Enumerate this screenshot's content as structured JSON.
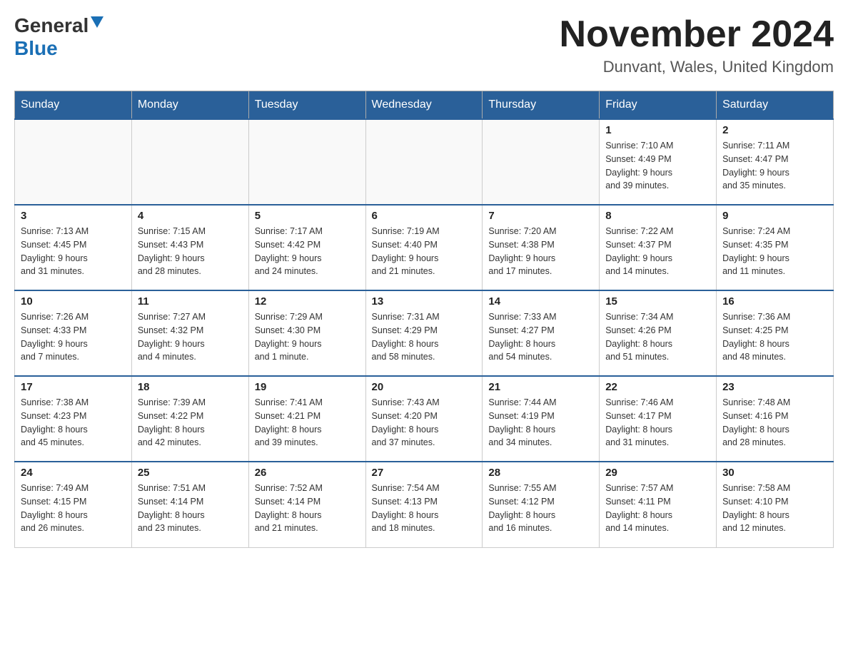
{
  "header": {
    "logo_general": "General",
    "logo_blue": "Blue",
    "title": "November 2024",
    "subtitle": "Dunvant, Wales, United Kingdom"
  },
  "weekdays": [
    "Sunday",
    "Monday",
    "Tuesday",
    "Wednesday",
    "Thursday",
    "Friday",
    "Saturday"
  ],
  "weeks": [
    [
      {
        "day": "",
        "info": ""
      },
      {
        "day": "",
        "info": ""
      },
      {
        "day": "",
        "info": ""
      },
      {
        "day": "",
        "info": ""
      },
      {
        "day": "",
        "info": ""
      },
      {
        "day": "1",
        "info": "Sunrise: 7:10 AM\nSunset: 4:49 PM\nDaylight: 9 hours\nand 39 minutes."
      },
      {
        "day": "2",
        "info": "Sunrise: 7:11 AM\nSunset: 4:47 PM\nDaylight: 9 hours\nand 35 minutes."
      }
    ],
    [
      {
        "day": "3",
        "info": "Sunrise: 7:13 AM\nSunset: 4:45 PM\nDaylight: 9 hours\nand 31 minutes."
      },
      {
        "day": "4",
        "info": "Sunrise: 7:15 AM\nSunset: 4:43 PM\nDaylight: 9 hours\nand 28 minutes."
      },
      {
        "day": "5",
        "info": "Sunrise: 7:17 AM\nSunset: 4:42 PM\nDaylight: 9 hours\nand 24 minutes."
      },
      {
        "day": "6",
        "info": "Sunrise: 7:19 AM\nSunset: 4:40 PM\nDaylight: 9 hours\nand 21 minutes."
      },
      {
        "day": "7",
        "info": "Sunrise: 7:20 AM\nSunset: 4:38 PM\nDaylight: 9 hours\nand 17 minutes."
      },
      {
        "day": "8",
        "info": "Sunrise: 7:22 AM\nSunset: 4:37 PM\nDaylight: 9 hours\nand 14 minutes."
      },
      {
        "day": "9",
        "info": "Sunrise: 7:24 AM\nSunset: 4:35 PM\nDaylight: 9 hours\nand 11 minutes."
      }
    ],
    [
      {
        "day": "10",
        "info": "Sunrise: 7:26 AM\nSunset: 4:33 PM\nDaylight: 9 hours\nand 7 minutes."
      },
      {
        "day": "11",
        "info": "Sunrise: 7:27 AM\nSunset: 4:32 PM\nDaylight: 9 hours\nand 4 minutes."
      },
      {
        "day": "12",
        "info": "Sunrise: 7:29 AM\nSunset: 4:30 PM\nDaylight: 9 hours\nand 1 minute."
      },
      {
        "day": "13",
        "info": "Sunrise: 7:31 AM\nSunset: 4:29 PM\nDaylight: 8 hours\nand 58 minutes."
      },
      {
        "day": "14",
        "info": "Sunrise: 7:33 AM\nSunset: 4:27 PM\nDaylight: 8 hours\nand 54 minutes."
      },
      {
        "day": "15",
        "info": "Sunrise: 7:34 AM\nSunset: 4:26 PM\nDaylight: 8 hours\nand 51 minutes."
      },
      {
        "day": "16",
        "info": "Sunrise: 7:36 AM\nSunset: 4:25 PM\nDaylight: 8 hours\nand 48 minutes."
      }
    ],
    [
      {
        "day": "17",
        "info": "Sunrise: 7:38 AM\nSunset: 4:23 PM\nDaylight: 8 hours\nand 45 minutes."
      },
      {
        "day": "18",
        "info": "Sunrise: 7:39 AM\nSunset: 4:22 PM\nDaylight: 8 hours\nand 42 minutes."
      },
      {
        "day": "19",
        "info": "Sunrise: 7:41 AM\nSunset: 4:21 PM\nDaylight: 8 hours\nand 39 minutes."
      },
      {
        "day": "20",
        "info": "Sunrise: 7:43 AM\nSunset: 4:20 PM\nDaylight: 8 hours\nand 37 minutes."
      },
      {
        "day": "21",
        "info": "Sunrise: 7:44 AM\nSunset: 4:19 PM\nDaylight: 8 hours\nand 34 minutes."
      },
      {
        "day": "22",
        "info": "Sunrise: 7:46 AM\nSunset: 4:17 PM\nDaylight: 8 hours\nand 31 minutes."
      },
      {
        "day": "23",
        "info": "Sunrise: 7:48 AM\nSunset: 4:16 PM\nDaylight: 8 hours\nand 28 minutes."
      }
    ],
    [
      {
        "day": "24",
        "info": "Sunrise: 7:49 AM\nSunset: 4:15 PM\nDaylight: 8 hours\nand 26 minutes."
      },
      {
        "day": "25",
        "info": "Sunrise: 7:51 AM\nSunset: 4:14 PM\nDaylight: 8 hours\nand 23 minutes."
      },
      {
        "day": "26",
        "info": "Sunrise: 7:52 AM\nSunset: 4:14 PM\nDaylight: 8 hours\nand 21 minutes."
      },
      {
        "day": "27",
        "info": "Sunrise: 7:54 AM\nSunset: 4:13 PM\nDaylight: 8 hours\nand 18 minutes."
      },
      {
        "day": "28",
        "info": "Sunrise: 7:55 AM\nSunset: 4:12 PM\nDaylight: 8 hours\nand 16 minutes."
      },
      {
        "day": "29",
        "info": "Sunrise: 7:57 AM\nSunset: 4:11 PM\nDaylight: 8 hours\nand 14 minutes."
      },
      {
        "day": "30",
        "info": "Sunrise: 7:58 AM\nSunset: 4:10 PM\nDaylight: 8 hours\nand 12 minutes."
      }
    ]
  ]
}
